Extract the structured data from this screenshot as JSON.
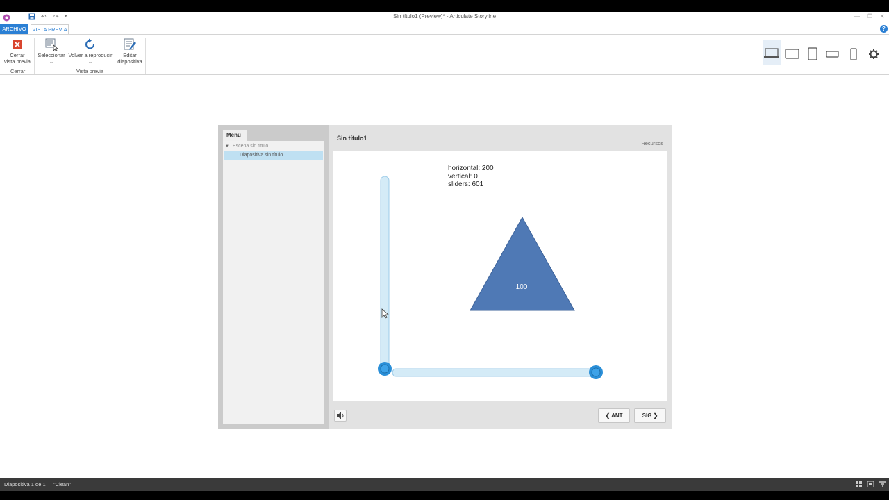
{
  "window": {
    "title": "Sin título1 (Preview)* - Articulate Storyline"
  },
  "ribbon": {
    "tabs": {
      "file": "ARCHIVO",
      "preview": "VISTA PREVIA"
    },
    "close_preview": {
      "line1": "Cerrar",
      "line2": "vista previa"
    },
    "group_close": "Cerrar",
    "select": {
      "label": "Seleccionar",
      "caret": "⌄"
    },
    "replay": {
      "label": "Volver a reproducir",
      "caret": "⌄"
    },
    "group_preview": "Vista previa",
    "edit_slide": {
      "line1": "Editar",
      "line2": "diapositiva"
    }
  },
  "player": {
    "menu_tab": "Menú",
    "scene": "Escena sin título",
    "slide_item": "Diapositiva sin título",
    "course_title": "Sin título1",
    "resources": "Recursos",
    "prev": "ANT",
    "next": "SIG"
  },
  "slide": {
    "readout": {
      "horizontal": "horizontal: 200",
      "vertical": "vertical: 0",
      "sliders": "sliders: 601"
    },
    "triangle_label": "100",
    "sliders": {
      "vertical_value": 0,
      "horizontal_value": 200
    }
  },
  "statusbar": {
    "slide": "Diapositiva 1 de 1",
    "theme": "\"Clean\""
  },
  "colors": {
    "accent": "#2a7fd4",
    "triangle": "#4f79b5",
    "slider_track": "#d4ebf7",
    "slider_thumb": "#2a8fd8",
    "menu_selected": "#bfe0f2"
  }
}
